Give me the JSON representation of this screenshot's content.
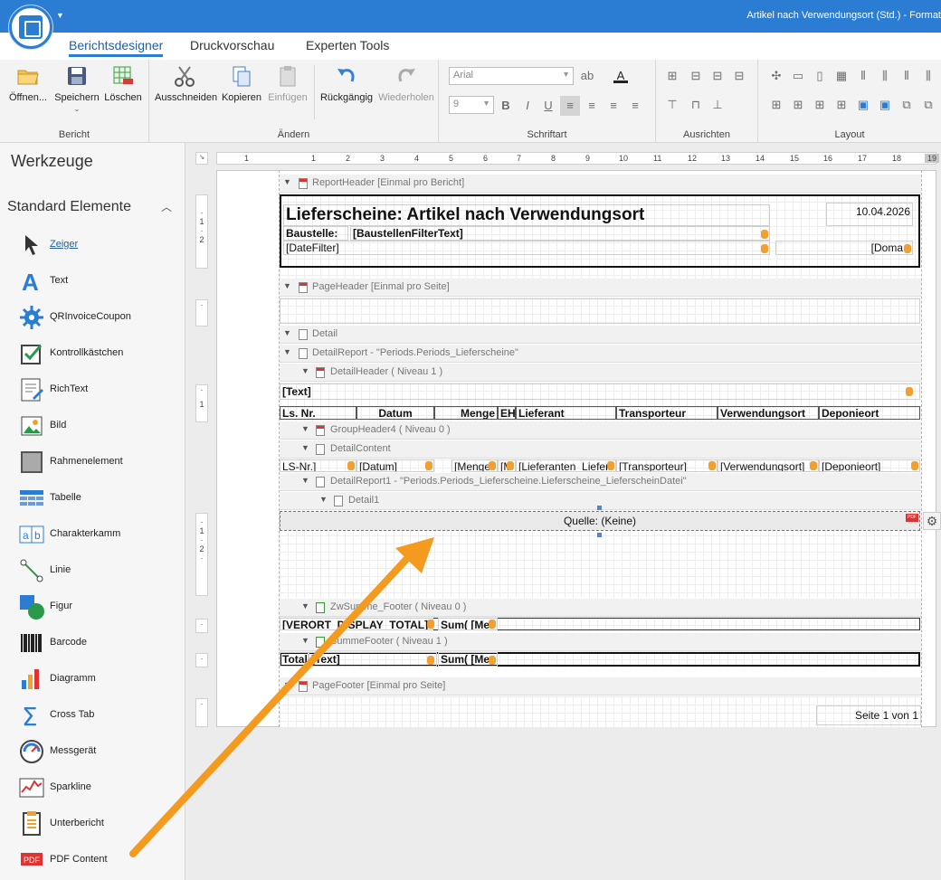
{
  "window": {
    "title": "Artikel nach Verwendungsort (Std.) - Format"
  },
  "tabs": [
    "Berichtsdesigner",
    "Druckvorschau",
    "Experten Tools"
  ],
  "ribbon": {
    "bericht": {
      "label": "Bericht",
      "open": "Öffnen...",
      "save": "Speichern",
      "delete": "Löschen"
    },
    "aendern": {
      "label": "Ändern",
      "cut": "Ausschneiden",
      "copy": "Kopieren",
      "paste": "Einfügen",
      "undo": "Rückgängig",
      "redo": "Wiederholen"
    },
    "schriftart": {
      "label": "Schriftart",
      "font": "Arial",
      "size": "9",
      "bold": "B",
      "italic": "I",
      "underline": "U"
    },
    "ausrichten": {
      "label": "Ausrichten"
    },
    "layout": {
      "label": "Layout"
    }
  },
  "sidebar": {
    "title": "Werkzeuge",
    "section": "Standard Elemente",
    "tools": [
      {
        "label": "Zeiger",
        "icon": "pointer-icon"
      },
      {
        "label": "Text",
        "icon": "text-icon"
      },
      {
        "label": "QRInvoiceCoupon",
        "icon": "gear-icon"
      },
      {
        "label": "Kontrollkästchen",
        "icon": "checkbox-icon"
      },
      {
        "label": "RichText",
        "icon": "richtext-icon"
      },
      {
        "label": "Bild",
        "icon": "image-icon"
      },
      {
        "label": "Rahmenelement",
        "icon": "panel-icon"
      },
      {
        "label": "Tabelle",
        "icon": "table-icon"
      },
      {
        "label": "Charakterkamm",
        "icon": "charcomb-icon"
      },
      {
        "label": "Linie",
        "icon": "line-icon"
      },
      {
        "label": "Figur",
        "icon": "shape-icon"
      },
      {
        "label": "Barcode",
        "icon": "barcode-icon"
      },
      {
        "label": "Diagramm",
        "icon": "chart-icon"
      },
      {
        "label": "Cross Tab",
        "icon": "sigma-icon"
      },
      {
        "label": "Messgerät",
        "icon": "gauge-icon"
      },
      {
        "label": "Sparkline",
        "icon": "sparkline-icon"
      },
      {
        "label": "Unterbericht",
        "icon": "subreport-icon"
      },
      {
        "label": "PDF Content",
        "icon": "pdf-icon"
      }
    ]
  },
  "ruler": [
    "1",
    "1",
    "2",
    "3",
    "4",
    "5",
    "6",
    "7",
    "8",
    "9",
    "10",
    "11",
    "12",
    "13",
    "14",
    "15",
    "16",
    "17",
    "18",
    "19"
  ],
  "report": {
    "bands": {
      "reportHeader": "ReportHeader [Einmal pro Bericht]",
      "pageHeader": "PageHeader [Einmal pro Seite]",
      "detail": "Detail",
      "detailReport": "DetailReport - \"Periods.Periods_Lieferscheine\"",
      "detailHeader": "DetailHeader",
      "detailHeaderLevel": "( Niveau 1 )",
      "groupHeader4": "GroupHeader4",
      "groupHeader4Level": "( Niveau 0 )",
      "detailContent": "DetailContent",
      "detailReport1": "DetailReport1 - \"Periods.Periods_Lieferscheine.Lieferscheine_LieferscheinDatei\"",
      "detail1": "Detail1",
      "zwSummeFooter": "ZwSumme_Footer",
      "zwSummeFooterLevel": "( Niveau 0 )",
      "summeFooter": "SummeFooter",
      "summeFooterLevel": "( Niveau 1 )",
      "pageFooter": "PageFooter [Einmal pro Seite]"
    },
    "header": {
      "title": "Lieferscheine: Artikel nach Verwendungsort",
      "date": "10.04.2026",
      "baustelleLabel": "Baustelle:",
      "baustelleValue": "[BaustellenFilterText]",
      "dateFilter": "[DateFilter]",
      "domain": "[Doma"
    },
    "detailHeaderText": "[Text]",
    "columns": [
      "Ls. Nr.",
      "Datum",
      "Menge",
      "EH",
      "Lieferant",
      "Transporteur",
      "Verwendungsort",
      "Deponieort"
    ],
    "rowFields": [
      "LS-Nr.]",
      "[Datum]",
      "[Menge",
      "[M",
      "[Lieferanten_Liefer",
      "[Transporteur]",
      "[Verwendungsort]",
      "[Deponieort]"
    ],
    "subreport": "Quelle: (Keine)",
    "zwSumme": [
      "[VERORT_DISPLAY_TOTAL]",
      "Sum( [Mer"
    ],
    "summe": [
      "Total",
      "[Text]",
      "Sum( [Mer"
    ],
    "pageNumber": "Seite 1 von 1"
  }
}
